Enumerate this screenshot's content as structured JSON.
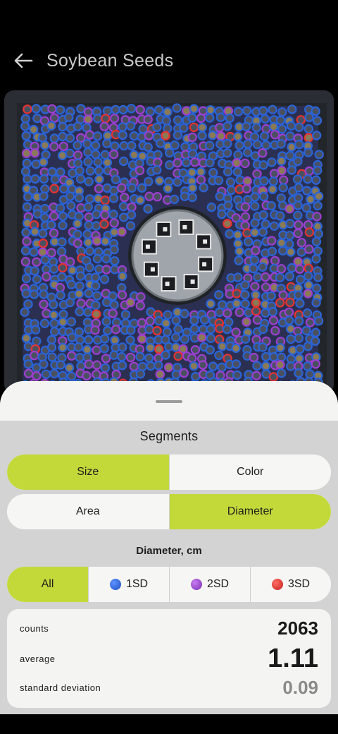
{
  "header": {
    "title": "Soybean Seeds"
  },
  "sheet": {
    "section_title": "Segments",
    "type_toggle": {
      "options": [
        "Size",
        "Color"
      ],
      "selected": "Size"
    },
    "metric_toggle": {
      "options": [
        "Area",
        "Diameter"
      ],
      "selected": "Diameter"
    },
    "metric_label": "Diameter, cm",
    "filter": {
      "options": [
        {
          "label": "All",
          "dot_color": ""
        },
        {
          "label": "1SD",
          "dot_color": "#2a63d6"
        },
        {
          "label": "2SD",
          "dot_color": "#9b3fd0"
        },
        {
          "label": "3SD",
          "dot_color": "#e53330"
        }
      ],
      "selected": "All"
    },
    "stats": {
      "counts_label": "counts",
      "counts_value": "2063",
      "average_label": "average",
      "average_value": "1.11",
      "sd_label": "standard deviation",
      "sd_value": "0.09"
    }
  },
  "colors": {
    "accent": "#c3d93a",
    "sd1": "#2a63d6",
    "sd2": "#9b3fd0",
    "sd3": "#e53330"
  }
}
